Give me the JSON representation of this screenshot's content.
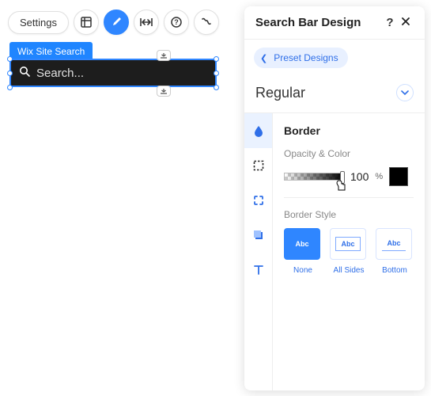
{
  "toolbar": {
    "settings_label": "Settings"
  },
  "canvas": {
    "tag_label": "Wix Site Search",
    "search_placeholder": "Search..."
  },
  "panel": {
    "title": "Search Bar Design",
    "preset_label": "Preset Designs",
    "state_label": "Regular",
    "section_title": "Border",
    "opacity_label": "Opacity & Color",
    "opacity_value": "100",
    "opacity_unit": "%",
    "border_style_label": "Border Style",
    "styles": {
      "none": "None",
      "all": "All Sides",
      "bottom": "Bottom",
      "sample": "Abc"
    },
    "swatch_color": "#000000"
  }
}
